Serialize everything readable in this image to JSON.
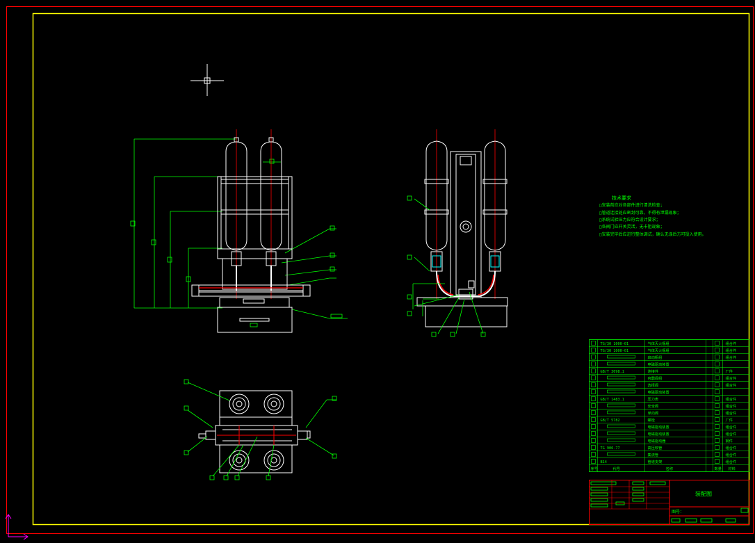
{
  "colors": {
    "background": "#000000",
    "outer_frame": "#ff0000",
    "inner_frame": "#ffff00",
    "drawing_lines": "#ffffff",
    "dimension_lines": "#00ff00",
    "centerlines": "#ff0000",
    "cursor": "#ffffff",
    "ucs_icon": "#ff00ff"
  },
  "icons": {
    "crosshair": "crosshair-cursor-icon",
    "ucs": "ucs-axis-icon"
  },
  "notes": {
    "heading": "技术要求",
    "lines": [
      "□安装前应对各部件进行清洗检查；",
      "□管道连接处应密封可靠，不得有泄漏现象；",
      "□系统试验压力应符合设计要求；",
      "□各阀门应开关灵活，无卡阻现象；",
      "□安装完毕后应进行整体调试，确认无误后方可投入使用。"
    ]
  },
  "bom_rows": [
    {
      "code": "TG/30 1000-01",
      "name": "气体灭火瓶组",
      "qty": "",
      "material": "组合件"
    },
    {
      "code": "TG/30 1000-01",
      "name": "气体灭火瓶组",
      "qty": "",
      "material": "组合件"
    },
    {
      "code": "",
      "name": "启动瓶组",
      "qty": "",
      "material": "组合件"
    },
    {
      "code": "",
      "name": "电磁驱动装置",
      "qty": "",
      "material": ""
    },
    {
      "code": "GB/T 3098.1",
      "name": "连接件",
      "qty": "",
      "material": "厂件"
    },
    {
      "code": "",
      "name": "容器阀组",
      "qty": "",
      "material": "组合件"
    },
    {
      "code": "",
      "name": "选择阀",
      "qty": "",
      "material": "组合件"
    },
    {
      "code": "",
      "name": "电磁驱动装置",
      "qty": "",
      "material": ""
    },
    {
      "code": "GB/T 1483.1",
      "name": "压力表",
      "qty": "",
      "material": "组合件"
    },
    {
      "code": "",
      "name": "安全阀",
      "qty": "",
      "material": "组合件"
    },
    {
      "code": "",
      "name": "单向阀",
      "qty": "",
      "material": "组合件"
    },
    {
      "code": "GB/T 5782",
      "name": "螺栓",
      "qty": "",
      "material": "厂件"
    },
    {
      "code": "",
      "name": "电磁驱动装置",
      "qty": "",
      "material": "组合件"
    },
    {
      "code": "",
      "name": "电磁驱动装置",
      "qty": "",
      "material": "组合件"
    },
    {
      "code": "",
      "name": "电磁驱动器",
      "qty": "",
      "material": "钢件"
    },
    {
      "code": "TG 906-77",
      "name": "高压软管",
      "qty": "",
      "material": "组合件"
    },
    {
      "code": "",
      "name": "集流管",
      "qty": "",
      "material": "组合件"
    },
    {
      "code": "B14",
      "name": "管道支架",
      "qty": "",
      "material": "组合件"
    }
  ],
  "bom_header": {
    "no": "序号",
    "code": "代号",
    "name": "名称",
    "qty": "数量",
    "material": "材料",
    "note": "备注"
  },
  "title_block": {
    "drawing_title": "装配图",
    "drawing_no_label": "图号："
  }
}
